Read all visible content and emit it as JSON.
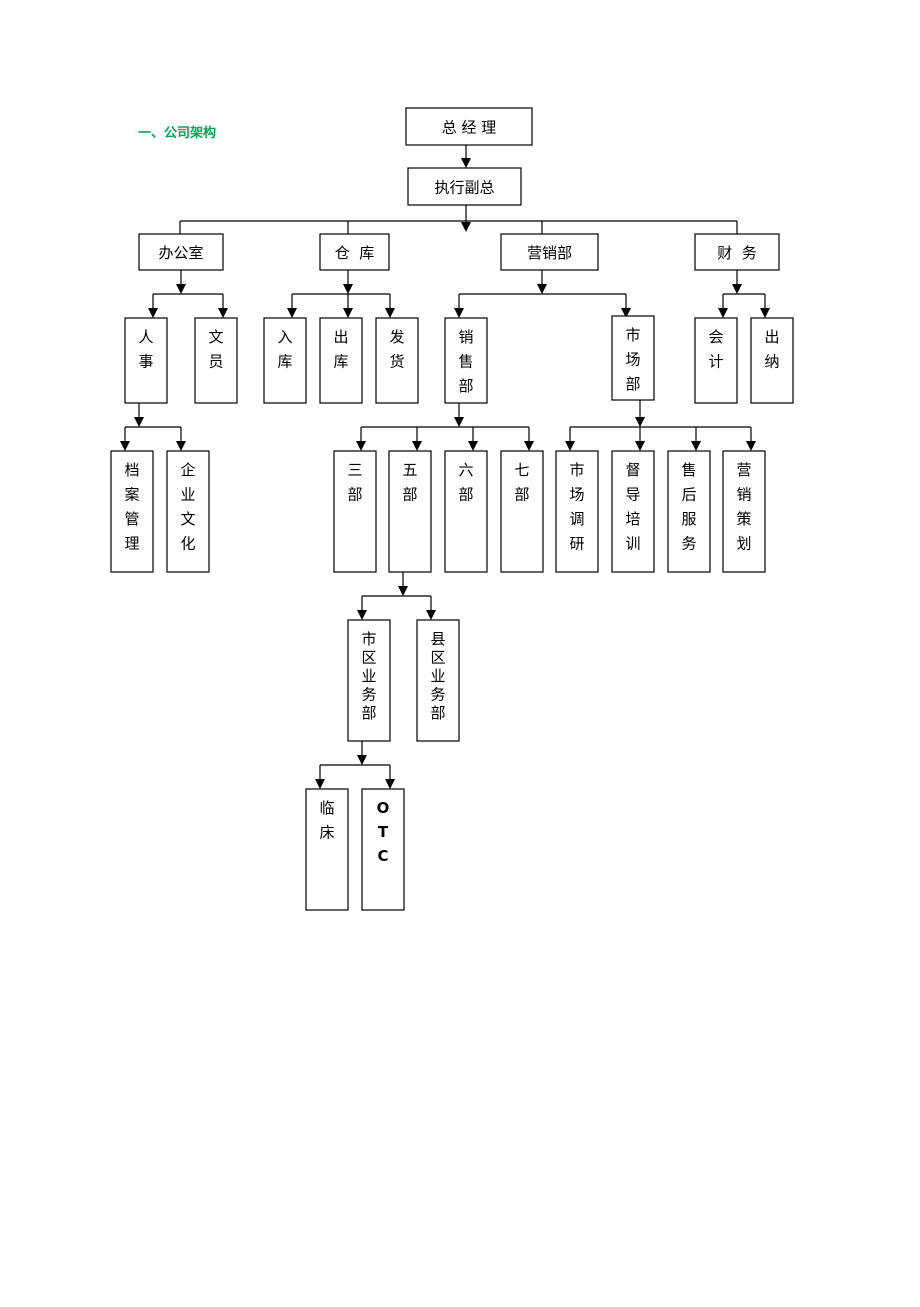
{
  "section_title": "一、公司架构",
  "colors": {
    "title": "#00a651",
    "line": "#000000"
  },
  "nodes": {
    "gm": "总 经 理",
    "evp": "执行副总",
    "office": "办公室",
    "warehouse": "仓  库",
    "marketing": "营销部",
    "finance": "财  务",
    "hr": "人事",
    "clerk": "文员",
    "inbound": "入库",
    "outbound": "出库",
    "shipping": "发货",
    "sales": "销售部",
    "market": "市场部",
    "accounting": "会计",
    "cashier": "出纳",
    "archives": "档案管理",
    "culture": "企业文化",
    "dept3": "三部",
    "dept5": "五部",
    "dept6": "六部",
    "dept7": "七部",
    "research": "市场调研",
    "training": "督导培训",
    "aftersales": "售后服务",
    "planning": "营销策划",
    "city": "市区业务部",
    "county": "县区业务部",
    "clinical": "临床",
    "otc": "OTC"
  }
}
